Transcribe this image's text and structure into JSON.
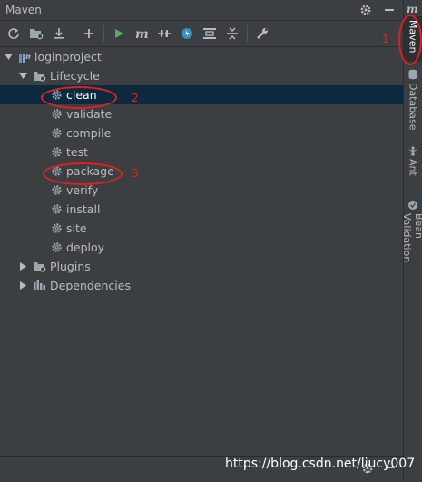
{
  "window": {
    "title": "Maven"
  },
  "right_tabs": [
    "Maven",
    "Database",
    "Ant",
    "Bean Validation"
  ],
  "toolbar": {
    "buttons": [
      "reload-icon",
      "generate-sources-icon",
      "download-icon",
      "add-icon",
      "run-icon",
      "maven-goal-icon",
      "toggle-offline-icon",
      "skip-tests-icon",
      "show-dependencies-icon",
      "collapse-all-icon",
      "settings-wrench-icon"
    ]
  },
  "tree": {
    "project": "loginproject",
    "lifecycle": {
      "label": "Lifecycle",
      "goals": [
        "clean",
        "validate",
        "compile",
        "test",
        "package",
        "verify",
        "install",
        "site",
        "deploy"
      ]
    },
    "plugins": "Plugins",
    "dependencies": "Dependencies"
  },
  "annotations": [
    "1",
    "2",
    "3"
  ],
  "watermark": "https://blog.csdn.net/liucy007",
  "colors": {
    "selection": "#0d293e",
    "annotation": "#e02020",
    "run": "#59a869",
    "background": "#3c3f41"
  }
}
